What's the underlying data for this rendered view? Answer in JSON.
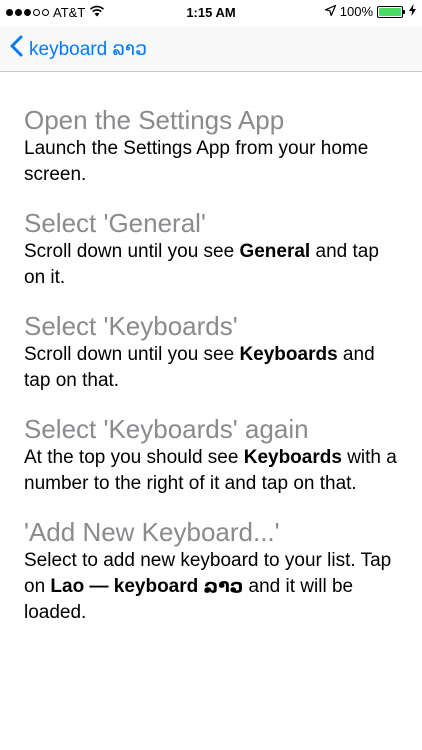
{
  "status_bar": {
    "carrier": "AT&T",
    "time": "1:15 AM",
    "battery_percent": "100%",
    "signal_bars_filled": 3,
    "signal_bars_total": 5,
    "battery_level": 1.0,
    "battery_color": "#4cd964"
  },
  "nav": {
    "back_label": "keyboard ລາວ",
    "accent_color": "#007aff"
  },
  "steps": [
    {
      "title": "Open the Settings App",
      "desc": "Launch the Settings App from your home screen."
    },
    {
      "title": "Select 'General'",
      "desc_pre": "Scroll down until you see ",
      "desc_bold": "General",
      "desc_post": " and tap on it."
    },
    {
      "title": "Select 'Keyboards'",
      "desc_pre": "Scroll down until you see ",
      "desc_bold": "Keyboards",
      "desc_post": " and tap on that."
    },
    {
      "title": "Select 'Keyboards' again",
      "desc_pre": "At the top you should see ",
      "desc_bold": "Keyboards",
      "desc_post": " with a number to the right of it and tap on that."
    },
    {
      "title": "'Add New Keyboard...'",
      "desc_pre": "Select to add new keyboard to your list. Tap on ",
      "desc_bold": "Lao — keyboard ລາວ",
      "desc_post": " and it will be loaded."
    }
  ],
  "icons": [
    "wifi-icon",
    "location-arrow-icon",
    "battery-icon",
    "charging-bolt-icon",
    "chevron-left-icon"
  ]
}
